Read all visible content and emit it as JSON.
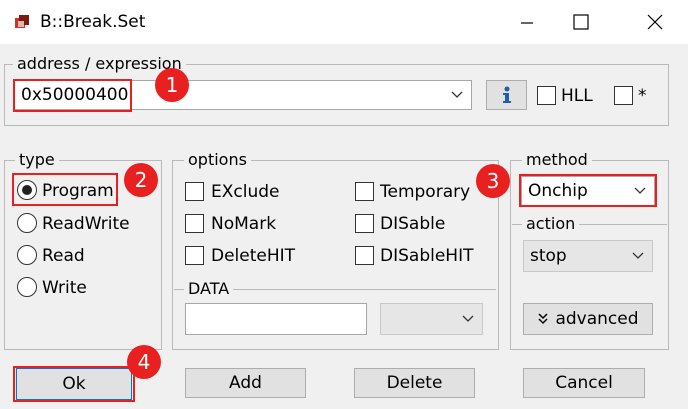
{
  "window": {
    "title": "B::Break.Set",
    "minimize_icon": "minimize-icon",
    "maximize_icon": "maximize-icon",
    "close_icon": "close-icon"
  },
  "address": {
    "legend": "address / expression",
    "value": "0x50000400",
    "info_icon": "info-icon",
    "hll_label": "HLL",
    "star_label": "*"
  },
  "type": {
    "legend": "type",
    "options": [
      "Program",
      "ReadWrite",
      "Read",
      "Write"
    ],
    "selected": "Program"
  },
  "options": {
    "legend": "options",
    "checkboxes": [
      "EXclude",
      "Temporary",
      "NoMark",
      "DISable",
      "DeleteHIT",
      "DISableHIT"
    ]
  },
  "data": {
    "legend": "DATA",
    "value": "",
    "select_value": ""
  },
  "method": {
    "legend": "method",
    "value": "Onchip"
  },
  "action": {
    "legend": "action",
    "value": "stop"
  },
  "advanced_label": "advanced",
  "buttons": {
    "ok": "Ok",
    "add": "Add",
    "delete": "Delete",
    "cancel": "Cancel"
  },
  "markers": [
    "1",
    "2",
    "3",
    "4"
  ],
  "colors": {
    "highlight": "#e8201f",
    "background": "#f0f0f0"
  }
}
